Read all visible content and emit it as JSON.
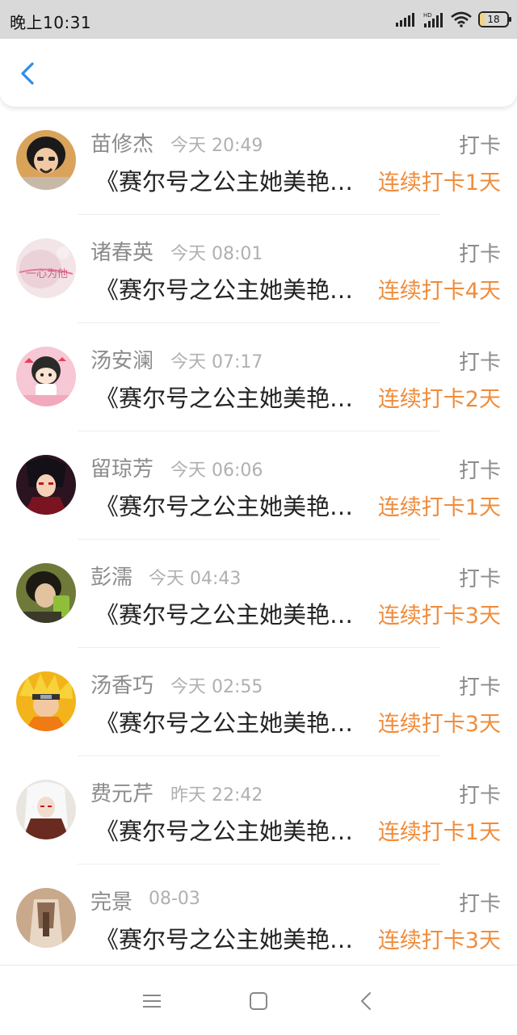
{
  "statusbar": {
    "time": "晚上10:31",
    "battery": "18",
    "icons": [
      "signal-icon",
      "hd-signal-icon",
      "wifi-icon",
      "battery-icon"
    ]
  },
  "header": {
    "back_icon": "chevron-left-icon"
  },
  "colors": {
    "accent": "#f08c3b",
    "back": "#2f8de4",
    "muted": "#8c8c8c"
  },
  "items": [
    {
      "name": "苗修杰",
      "time": "今天 20:49",
      "action": "打卡",
      "title": "《赛尔号之公主她美艳…",
      "streak": "连续打卡1天"
    },
    {
      "name": "诸春英",
      "time": "今天 08:01",
      "action": "打卡",
      "title": "《赛尔号之公主她美艳…",
      "streak": "连续打卡4天"
    },
    {
      "name": "汤安澜",
      "time": "今天 07:17",
      "action": "打卡",
      "title": "《赛尔号之公主她美艳…",
      "streak": "连续打卡2天"
    },
    {
      "name": "留琼芳",
      "time": "今天 06:06",
      "action": "打卡",
      "title": "《赛尔号之公主她美艳…",
      "streak": "连续打卡1天"
    },
    {
      "name": "彭濡",
      "time": "今天 04:43",
      "action": "打卡",
      "title": "《赛尔号之公主她美艳…",
      "streak": "连续打卡3天"
    },
    {
      "name": "汤香巧",
      "time": "今天 02:55",
      "action": "打卡",
      "title": "《赛尔号之公主她美艳…",
      "streak": "连续打卡3天"
    },
    {
      "name": "费元芹",
      "time": "昨天 22:42",
      "action": "打卡",
      "title": "《赛尔号之公主她美艳…",
      "streak": "连续打卡1天"
    },
    {
      "name": "完景",
      "time": "08-03",
      "action": "打卡",
      "title": "《赛尔号之公主她美艳…",
      "streak": "连续打卡3天"
    }
  ],
  "navbar": {
    "icons": [
      "menu-icon",
      "home-square-icon",
      "back-triangle-icon"
    ]
  }
}
